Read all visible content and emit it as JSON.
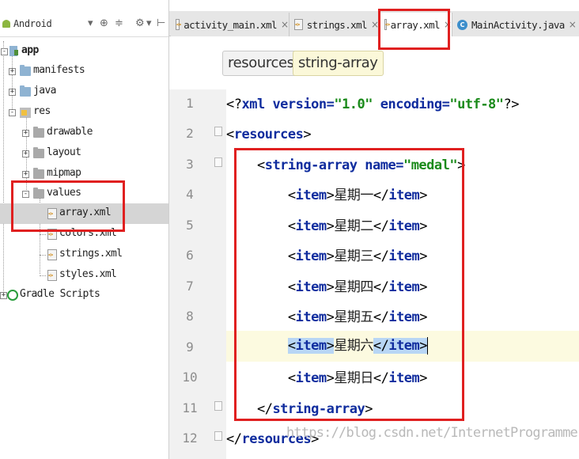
{
  "project_panel": {
    "view_selector": "Android",
    "tree": [
      {
        "label": "app",
        "bold": true
      },
      {
        "label": "manifests"
      },
      {
        "label": "java"
      },
      {
        "label": "res"
      },
      {
        "label": "drawable"
      },
      {
        "label": "layout"
      },
      {
        "label": "mipmap"
      },
      {
        "label": "values"
      },
      {
        "label": "array.xml"
      },
      {
        "label": "colors.xml"
      },
      {
        "label": "strings.xml"
      },
      {
        "label": "styles.xml"
      },
      {
        "label": "Gradle Scripts"
      }
    ]
  },
  "editor": {
    "tabs": [
      {
        "label": "activity_main.xml",
        "close": "×"
      },
      {
        "label": "strings.xml",
        "close": "×"
      },
      {
        "label": "array.xml",
        "close": "×",
        "active": true
      },
      {
        "label": "MainActivity.java",
        "close": "×"
      }
    ],
    "breadcrumb": [
      "resources",
      "string-array"
    ],
    "line_numbers": [
      "1",
      "2",
      "3",
      "4",
      "5",
      "6",
      "7",
      "8",
      "9",
      "10",
      "11",
      "12"
    ],
    "code": {
      "l1_open": "<?",
      "l1_xml": "xml",
      "l1_version_attr": " version=",
      "l1_version_val": "\"1.0\"",
      "l1_encoding_attr": " encoding=",
      "l1_encoding_val": "\"utf-8\"",
      "l1_close": "?>",
      "resources_tag": "resources",
      "string_array_tag": "string-array",
      "name_attr": " name=",
      "name_val": "\"medal\"",
      "item_tag": "item",
      "items": [
        "星期一",
        "星期二",
        "星期三",
        "星期四",
        "星期五",
        "星期六",
        "星期日"
      ]
    }
  },
  "watermark": "https://blog.csdn.net/InternetProgrammers",
  "colors": {
    "annotation": "#e02020",
    "tag": "#0f2c9e",
    "value": "#1a8a1a",
    "selection": "#b8d6f5",
    "current_line": "#fcfae0"
  }
}
